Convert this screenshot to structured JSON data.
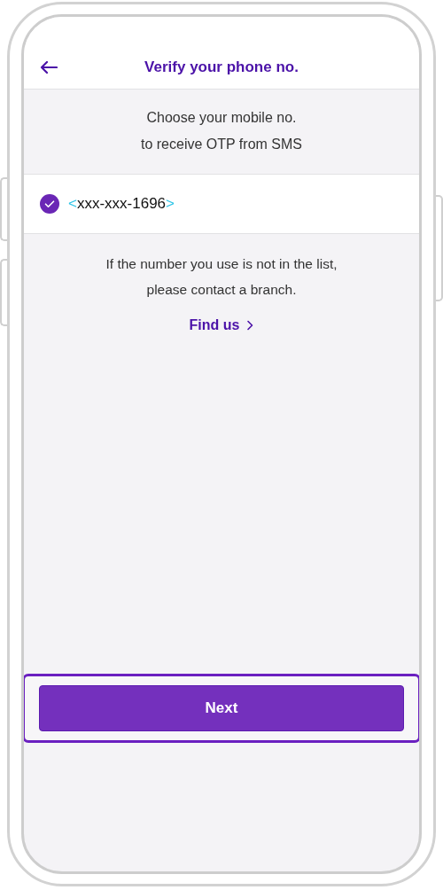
{
  "header": {
    "title": "Verify your phone no."
  },
  "instruction": [
    "Choose your mobile no.",
    "to receive OTP from SMS"
  ],
  "phone_options": [
    {
      "bracket_open": "<",
      "number": "xxx-xxx-1696",
      "bracket_close": ">",
      "selected": true
    }
  ],
  "note": [
    "If the number you use is not in the list,",
    "please contact a branch."
  ],
  "link": {
    "label": "Find us"
  },
  "primary_button": {
    "label": "Next",
    "focused": true
  }
}
